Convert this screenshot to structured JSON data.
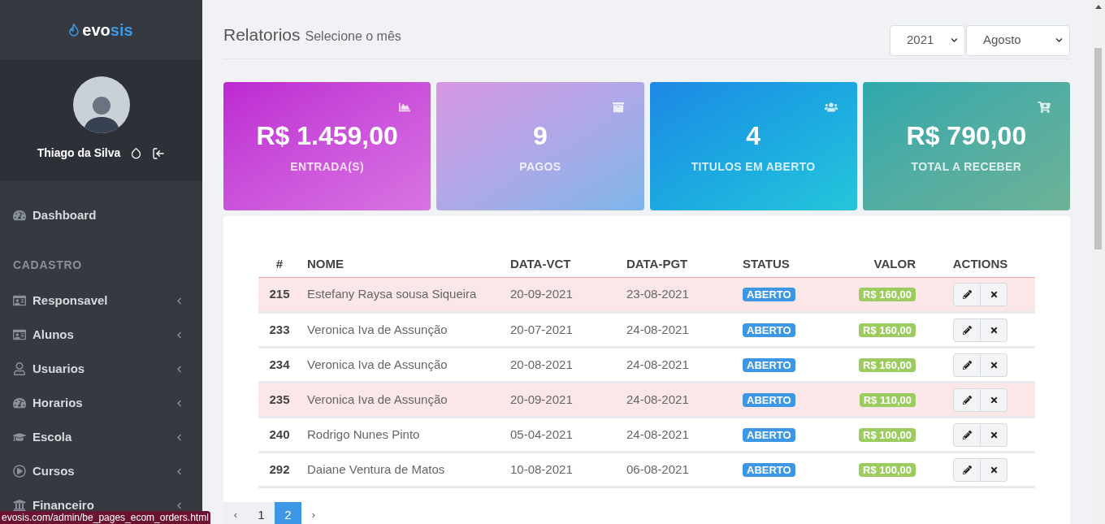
{
  "sidebar": {
    "logo": {
      "text": "evo",
      "accent": "sis"
    },
    "user": {
      "name": "Thiago da Silva"
    },
    "top_items": [
      {
        "label": "Dashboard"
      }
    ],
    "sections": [
      {
        "title": "CADASTRO",
        "items": [
          {
            "label": "Responsavel",
            "expanded": false
          },
          {
            "label": "Alunos",
            "expanded": false
          },
          {
            "label": "Usuarios",
            "expanded": false
          },
          {
            "label": "Horarios",
            "expanded": false
          },
          {
            "label": "Escola",
            "expanded": false
          },
          {
            "label": "Cursos",
            "expanded": false
          },
          {
            "label": "Financeiro",
            "expanded": false
          }
        ]
      }
    ]
  },
  "header": {
    "title": "Relatorios",
    "subtitle": "Selecione o mês",
    "year_select": {
      "value": "2021"
    },
    "month_select": {
      "value": "Agosto"
    }
  },
  "stat_cards": [
    {
      "value": "R$ 1.459,00",
      "label": "ENTRADA(S)"
    },
    {
      "value": "9",
      "label": "PAGOS"
    },
    {
      "value": "4",
      "label": "TITULOS EM ABERTO"
    },
    {
      "value": "R$ 790,00",
      "label": "TOTAL A RECEBER"
    }
  ],
  "table": {
    "columns": [
      "#",
      "NOME",
      "DATA-VCT",
      "DATA-PGT",
      "STATUS",
      "VALOR",
      "ACTIONS"
    ],
    "rows": [
      {
        "id": "215",
        "name": "Estefany Raysa sousa Siqueira",
        "due": "20-09-2021",
        "paid": "23-08-2021",
        "status": "ABERTO",
        "value": "R$ 160,00",
        "highlighted": true
      },
      {
        "id": "233",
        "name": "Veronica Iva de Assunção",
        "due": "20-07-2021",
        "paid": "24-08-2021",
        "status": "ABERTO",
        "value": "R$ 160,00",
        "highlighted": false
      },
      {
        "id": "234",
        "name": "Veronica Iva de Assunção",
        "due": "20-08-2021",
        "paid": "24-08-2021",
        "status": "ABERTO",
        "value": "R$ 160,00",
        "highlighted": false
      },
      {
        "id": "235",
        "name": "Veronica Iva de Assunção",
        "due": "20-09-2021",
        "paid": "24-08-2021",
        "status": "ABERTO",
        "value": "R$ 110,00",
        "highlighted": true
      },
      {
        "id": "240",
        "name": "Rodrigo Nunes Pinto",
        "due": "05-04-2021",
        "paid": "24-08-2021",
        "status": "ABERTO",
        "value": "R$ 100,00",
        "highlighted": false
      },
      {
        "id": "292",
        "name": "Daiane Ventura de Matos",
        "due": "10-08-2021",
        "paid": "06-08-2021",
        "status": "ABERTO",
        "value": "R$ 100,00",
        "highlighted": false
      }
    ]
  },
  "pagination": {
    "prev": "‹",
    "pages": [
      {
        "label": "1",
        "selected": false
      },
      {
        "label": "2",
        "selected": true
      }
    ],
    "next": "›"
  },
  "status_url": "evosis.com/admin/be_pages_ecom_orders.html"
}
